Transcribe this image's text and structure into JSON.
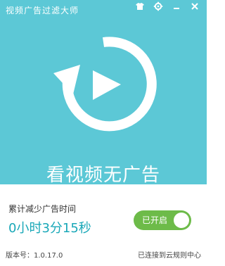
{
  "window": {
    "title": "视频广告过滤大师",
    "icons": [
      "shirt-icon",
      "gear-icon",
      "minimize-icon",
      "close-icon"
    ]
  },
  "hero": {
    "tagline": "看视频无广告",
    "icon": "replay-play-icon"
  },
  "stats": {
    "label": "累计减少广告时间",
    "value": "0小时3分15秒"
  },
  "toggle": {
    "label": "已开启",
    "state": true
  },
  "footer": {
    "version": "版本号：1.0.17.0",
    "cloud_status": "已连接到云规则中心"
  },
  "colors": {
    "accent": "#5cc8d6",
    "value_text": "#1aa8b8",
    "toggle_on": "#6dbb49"
  }
}
